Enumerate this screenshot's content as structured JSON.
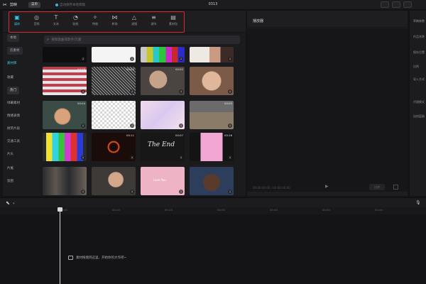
{
  "app": {
    "logo_text": "剪映",
    "menu_label": "菜单",
    "autosave_text": "自动保存本地草稿",
    "project_title": "0313"
  },
  "toolbar": {
    "items": [
      {
        "label": "媒体",
        "icon": "media-icon",
        "active": true
      },
      {
        "label": "音频",
        "icon": "audio-icon",
        "active": false
      },
      {
        "label": "文本",
        "icon": "text-icon",
        "active": false
      },
      {
        "label": "贴纸",
        "icon": "sticker-icon",
        "active": false
      },
      {
        "label": "特效",
        "icon": "effects-icon",
        "active": false
      },
      {
        "label": "转场",
        "icon": "transition-icon",
        "active": false
      },
      {
        "label": "滤镜",
        "icon": "filter-icon",
        "active": false
      },
      {
        "label": "调节",
        "icon": "adjust-icon",
        "active": false
      },
      {
        "label": "素材包",
        "icon": "material-pack-icon",
        "active": false
      }
    ],
    "highlight_color": "#e0262d",
    "accent_color": "#3cc6e3"
  },
  "sidebar": {
    "items": [
      {
        "label": "本地",
        "style": "pill"
      },
      {
        "label": "云素材",
        "style": "pill"
      },
      {
        "label": "素材库",
        "style": "active"
      },
      {
        "label": "收藏",
        "style": "normal"
      },
      {
        "label": "热门",
        "style": "selected"
      },
      {
        "label": "绿幕素材",
        "style": "normal"
      },
      {
        "label": "情绪表情",
        "style": "normal"
      },
      {
        "label": "搞笑片段",
        "style": "normal"
      },
      {
        "label": "交通工具",
        "style": "normal"
      },
      {
        "label": "片头",
        "style": "normal"
      },
      {
        "label": "片尾",
        "style": "normal"
      },
      {
        "label": "氛围",
        "style": "normal"
      },
      {
        "label": "背景",
        "style": "normal"
      }
    ]
  },
  "library": {
    "search_placeholder": "搜索歌曲或歌手/元素",
    "tiles": [
      {
        "kind": "dark",
        "duration": ""
      },
      {
        "kind": "white",
        "duration": ""
      },
      {
        "kind": "colorbars",
        "duration": ""
      },
      {
        "kind": "photo-people",
        "duration": ""
      },
      {
        "kind": "flag",
        "duration": "00:08"
      },
      {
        "kind": "static",
        "duration": "00:03"
      },
      {
        "kind": "photo-man",
        "duration": "00:02"
      },
      {
        "kind": "photo-laugh",
        "duration": ""
      },
      {
        "kind": "photo-cartoon",
        "duration": "00:04"
      },
      {
        "kind": "checker",
        "duration": ""
      },
      {
        "kind": "pink-floral",
        "duration": ""
      },
      {
        "kind": "photo-street",
        "duration": "00:05"
      },
      {
        "kind": "testcard",
        "duration": ""
      },
      {
        "kind": "fire-ring",
        "duration": "00:11"
      },
      {
        "kind": "the-end",
        "duration": "00:07"
      },
      {
        "kind": "pink-portrait",
        "duration": "00:16"
      },
      {
        "kind": "photo-crowd",
        "duration": ""
      },
      {
        "kind": "photo-woman",
        "duration": ""
      },
      {
        "kind": "pink-text",
        "duration": ""
      },
      {
        "kind": "photo-portrait",
        "duration": ""
      }
    ],
    "tile_end_text": "The End",
    "tile_pink_text": "Love You"
  },
  "player": {
    "title": "播放器",
    "timecode": "00:00:00:00 / 00:00:00:00",
    "ratio_label": "比例"
  },
  "properties": {
    "lines": [
      "草稿参数",
      "作品名称",
      "保存位置",
      "比例",
      "导入方式",
      "代理模式",
      "自由层级"
    ]
  },
  "timeline": {
    "ticks": [
      "00:00",
      "00:10",
      "00:20",
      "00:30",
      "00:40",
      "00:50",
      "01:00",
      "01:10"
    ],
    "drop_hint": "素材拖拽到这里，开始你的大作吧~"
  }
}
